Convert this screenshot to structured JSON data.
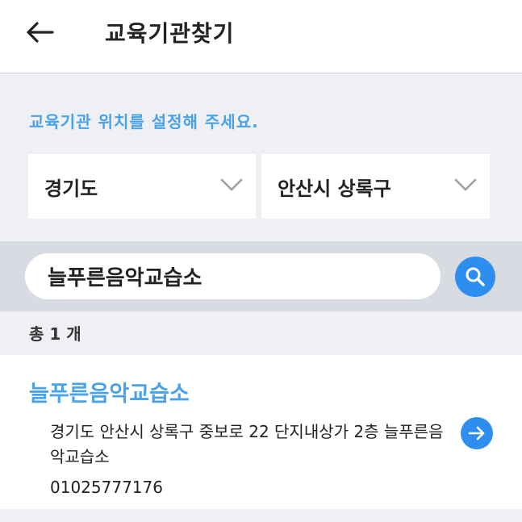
{
  "header": {
    "title": "교육기관찾기",
    "back_icon": "arrow-left-icon"
  },
  "guide_text": "교육기관 위치를 설정해 주세요.",
  "region": {
    "province": "경기도",
    "district": "안산시 상록구"
  },
  "search": {
    "value": "늘푸른음악교습소",
    "icon": "search-icon"
  },
  "result_count": "총 1 개",
  "results": [
    {
      "name": "늘푸른음악교습소",
      "address": "경기도 안산시 상록구 중보로 22 단지내상가 2층 늘푸른음악교습소",
      "phone": "01025777176",
      "icon": "arrow-right-icon"
    }
  ],
  "colors": {
    "accent": "#2e8ef0",
    "accent_text": "#4aa3e8",
    "background": "#eef0f3",
    "search_band": "#d8dce2"
  }
}
